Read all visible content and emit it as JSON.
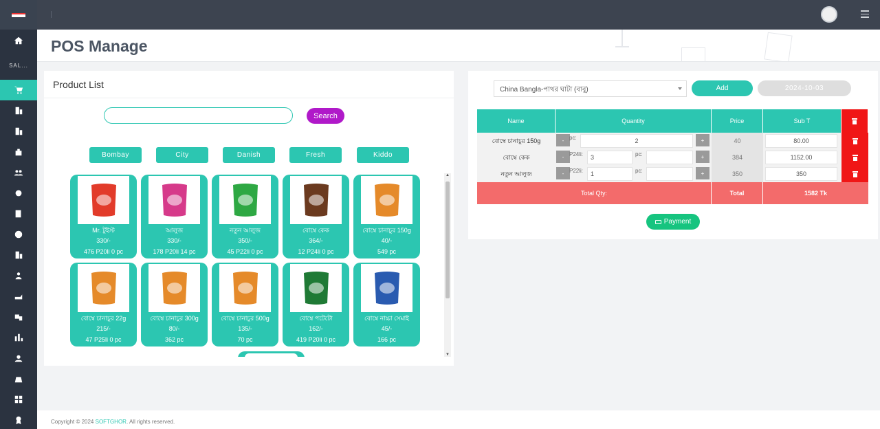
{
  "header": {
    "page_title": "POS Manage"
  },
  "sidebar": {
    "sales_label": "SAL..."
  },
  "product_list": {
    "title": "Product List",
    "search": {
      "value": "",
      "placeholder": "",
      "button_label": "Search"
    },
    "categories": [
      "Bombay",
      "City",
      "Danish",
      "Fresh",
      "Kiddo"
    ],
    "products": [
      {
        "name": "Mr. টুইস্ট",
        "price": "330/-",
        "stock": "476 P20li 0 pc",
        "color": "#e23b2a"
      },
      {
        "name": "আলুজ",
        "price": "330/-",
        "stock": "178 P20li 14 pc",
        "color": "#d63a8a"
      },
      {
        "name": "নতুন আলুজ",
        "price": "350/-",
        "stock": "45 P22li 0 pc",
        "color": "#2ea843"
      },
      {
        "name": "বোম্বে কেক",
        "price": "364/-",
        "stock": "12 P24li 0 pc",
        "color": "#6b3a1f"
      },
      {
        "name": "বোম্বে চানাচুর 150g",
        "price": "40/-",
        "stock": "549 pc",
        "color": "#e58a2a"
      },
      {
        "name": "বোম্বে চানাচুর 22g",
        "price": "215/-",
        "stock": "47 P25li 0 pc",
        "color": "#e58a2a"
      },
      {
        "name": "বোম্বে চানাচুর 300g",
        "price": "80/-",
        "stock": "362 pc",
        "color": "#e58a2a"
      },
      {
        "name": "বোম্বে চানাচুর 500g",
        "price": "135/-",
        "stock": "70 pc",
        "color": "#e58a2a"
      },
      {
        "name": "বোম্বে পটেটো",
        "price": "162/-",
        "stock": "419 P20li 0 pc",
        "color": "#1f7a35"
      },
      {
        "name": "বোম্বে নাচ্চা সেমাই",
        "price": "45/-",
        "stock": "166 pc",
        "color": "#2a5bb0"
      }
    ]
  },
  "order": {
    "customer_select": "China Bangla-পাথর ঘাটা (বাবু)",
    "add_label": "Add",
    "date": "2024-10-03",
    "columns": {
      "name": "Name",
      "quantity": "Quantity",
      "price": "Price",
      "subtotal": "Sub T"
    },
    "rows": [
      {
        "name": "বোম্বে চানাচুর 150g",
        "minus": "-",
        "plus": "+",
        "unit1_label": "pc:",
        "unit1_value": "2",
        "unit2_label": "",
        "unit2_value": "",
        "price": "40",
        "subtotal": "80.00"
      },
      {
        "name": "বোম্বে কেক",
        "minus": "-",
        "plus": "+",
        "unit1_label": "P24li:",
        "unit1_value": "3",
        "unit2_label": "pc:",
        "unit2_value": "",
        "price": "384",
        "subtotal": "1152.00"
      },
      {
        "name": "নতুন আলুজ",
        "minus": "-",
        "plus": "+",
        "unit1_label": "P22li:",
        "unit1_value": "1",
        "unit2_label": "pc:",
        "unit2_value": "",
        "price": "350",
        "subtotal": "350"
      }
    ],
    "totals": {
      "qty_label": "Total Qty:",
      "total_label": "Total",
      "amount": "1582 Tk"
    },
    "payment_label": "Payment"
  },
  "footer": {
    "prefix": "Copyright © 2024 ",
    "brand": "SOFTGHOR",
    "suffix": ". All rights reserved."
  },
  "colors": {
    "accent": "#2cc6b1",
    "danger": "#f01616",
    "search": "#b019c9",
    "payment": "#16c47f"
  }
}
